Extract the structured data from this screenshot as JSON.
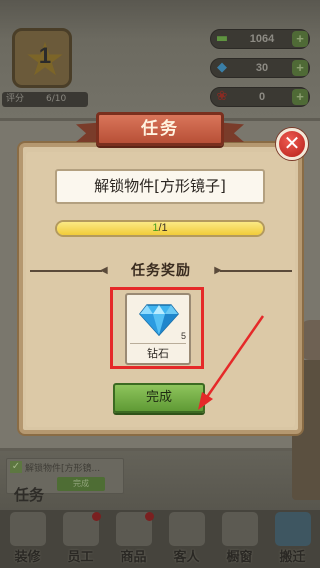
{
  "hud": {
    "level": "1",
    "rating_label": "评分",
    "rating_value": "6/10",
    "resources": [
      {
        "icon": "cash-icon",
        "value": "1064",
        "color": "#5f9440"
      },
      {
        "icon": "diamond-icon",
        "value": "30",
        "color": "#3aa0d8"
      },
      {
        "icon": "rose-icon",
        "value": "0",
        "color": "#c0302a"
      }
    ],
    "plus": "+"
  },
  "dialog": {
    "title": "任务",
    "close": "✕",
    "task_text": "解锁物件[方形镜子]",
    "progress": {
      "done": "1",
      "total": "/1",
      "fraction": 1.0
    },
    "reward_header": "任务奖励",
    "reward": {
      "icon": "diamond-icon",
      "count": "5",
      "name": "钻石"
    },
    "complete_label": "完成"
  },
  "task_panel": {
    "text": "解锁物件[方形镜...",
    "button": "完成",
    "label": "任务"
  },
  "tabs": [
    {
      "label": "装修",
      "icon": "toolbox-icon",
      "dot": false,
      "count": "",
      "blue": false
    },
    {
      "label": "员工",
      "icon": "staff-icon",
      "dot": true,
      "count": "",
      "blue": false
    },
    {
      "label": "商品",
      "icon": "plant-icon",
      "dot": true,
      "count": "",
      "blue": false
    },
    {
      "label": "客人",
      "icon": "customer-icon",
      "dot": false,
      "count": "",
      "blue": false
    },
    {
      "label": "橱窗",
      "icon": "window-icon",
      "dot": false,
      "count": "",
      "blue": false
    },
    {
      "label": "搬迁",
      "icon": "relocate-icon",
      "dot": false,
      "count": "",
      "blue": true
    }
  ]
}
